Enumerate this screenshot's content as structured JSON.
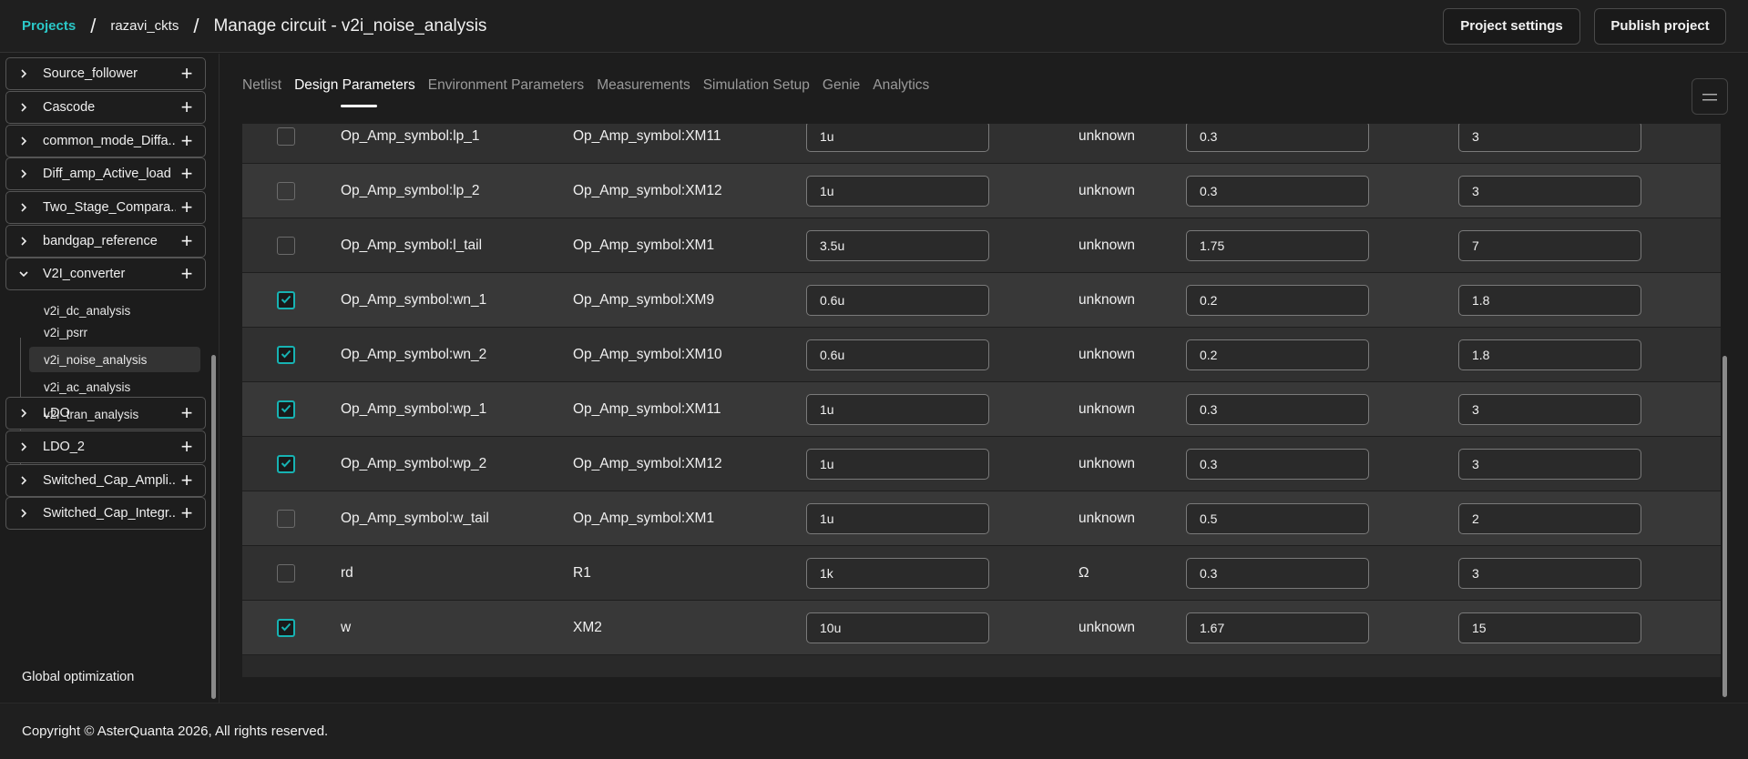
{
  "header": {
    "breadcrumb_projects": "Projects",
    "breadcrumb_sep": "/",
    "breadcrumb_folder": "razavi_ckts",
    "title": "Manage circuit - v2i_noise_analysis",
    "project_settings": "Project settings",
    "publish_project": "Publish project"
  },
  "sidebar": {
    "items": [
      {
        "label": "Source_follower",
        "expanded": false
      },
      {
        "label": "Cascode",
        "expanded": false
      },
      {
        "label": "common_mode_Diffa...",
        "expanded": false
      },
      {
        "label": "Diff_amp_Active_load",
        "expanded": false
      },
      {
        "label": "Two_Stage_Compara...",
        "expanded": false
      },
      {
        "label": "bandgap_reference",
        "expanded": false
      },
      {
        "label": "V2I_converter",
        "expanded": true
      },
      {
        "label": "LDO",
        "expanded": false
      },
      {
        "label": "LDO_2",
        "expanded": false
      },
      {
        "label": "Switched_Cap_Ampli...",
        "expanded": false
      },
      {
        "label": "Switched_Cap_Integr...",
        "expanded": false
      }
    ],
    "children": [
      {
        "label": "v2i_dc_analysis",
        "active": false
      },
      {
        "label": "v2i_psrr",
        "active": false
      },
      {
        "label": "v2i_noise_analysis",
        "active": true
      },
      {
        "label": "v2i_ac_analysis",
        "active": false
      },
      {
        "label": "v2i_tran_analysis",
        "active": false
      }
    ],
    "global_optimization": "Global optimization"
  },
  "tabs": [
    {
      "label": "Netlist",
      "active": false
    },
    {
      "label": "Design Parameters",
      "active": true
    },
    {
      "label": "Environment Parameters",
      "active": false
    },
    {
      "label": "Measurements",
      "active": false
    },
    {
      "label": "Simulation Setup",
      "active": false
    },
    {
      "label": "Genie",
      "active": false
    },
    {
      "label": "Analytics",
      "active": false
    }
  ],
  "menu_icon": "hamburger-icon",
  "accent_color": "#17b3b3",
  "parameters": [
    {
      "checked": false,
      "name": "Op_Amp_symbol:lp_1",
      "instance": "Op_Amp_symbol:XM11",
      "value": "1u",
      "unit": "unknown",
      "min": "0.3",
      "max": "3"
    },
    {
      "checked": false,
      "name": "Op_Amp_symbol:lp_2",
      "instance": "Op_Amp_symbol:XM12",
      "value": "1u",
      "unit": "unknown",
      "min": "0.3",
      "max": "3"
    },
    {
      "checked": false,
      "name": "Op_Amp_symbol:l_tail",
      "instance": "Op_Amp_symbol:XM1",
      "value": "3.5u",
      "unit": "unknown",
      "min": "1.75",
      "max": "7"
    },
    {
      "checked": true,
      "name": "Op_Amp_symbol:wn_1",
      "instance": "Op_Amp_symbol:XM9",
      "value": "0.6u",
      "unit": "unknown",
      "min": "0.2",
      "max": "1.8"
    },
    {
      "checked": true,
      "name": "Op_Amp_symbol:wn_2",
      "instance": "Op_Amp_symbol:XM10",
      "value": "0.6u",
      "unit": "unknown",
      "min": "0.2",
      "max": "1.8"
    },
    {
      "checked": true,
      "name": "Op_Amp_symbol:wp_1",
      "instance": "Op_Amp_symbol:XM11",
      "value": "1u",
      "unit": "unknown",
      "min": "0.3",
      "max": "3"
    },
    {
      "checked": true,
      "name": "Op_Amp_symbol:wp_2",
      "instance": "Op_Amp_symbol:XM12",
      "value": "1u",
      "unit": "unknown",
      "min": "0.3",
      "max": "3"
    },
    {
      "checked": false,
      "name": "Op_Amp_symbol:w_tail",
      "instance": "Op_Amp_symbol:XM1",
      "value": "1u",
      "unit": "unknown",
      "min": "0.5",
      "max": "2"
    },
    {
      "checked": false,
      "name": "rd",
      "instance": "R1",
      "value": "1k",
      "unit": "Ω",
      "min": "0.3",
      "max": "3"
    },
    {
      "checked": true,
      "name": "w",
      "instance": "XM2",
      "value": "10u",
      "unit": "unknown",
      "min": "1.67",
      "max": "15"
    }
  ],
  "footer": {
    "copyright": "Copyright © AsterQuanta 2026, All rights reserved."
  }
}
